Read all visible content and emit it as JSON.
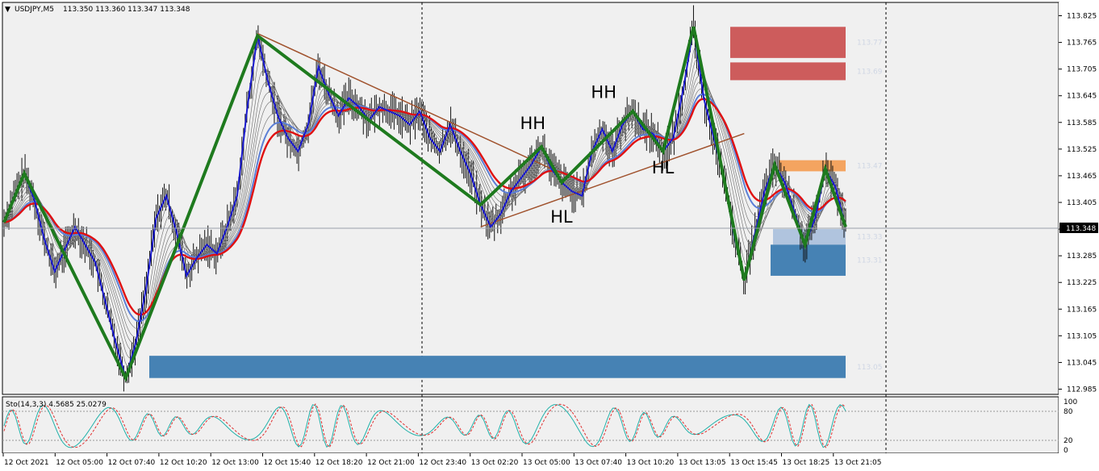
{
  "window": {
    "symbol_title": "USDJPY,M5",
    "ohlc": "113.350 113.360 113.347 113.348",
    "current_price": "113.348",
    "stochastic_label": "Sto(14,3,3) 4.5685 25.0279"
  },
  "colors": {
    "background": "#f0f0f0",
    "bull_candle": "#000000",
    "price_zigzag": "#1a1ad0",
    "trend_zigzag": "#1e7a1e",
    "trend_line": "#a0522d",
    "ema_red": "#e01010",
    "ema_blue": "#5b7fd6",
    "sell_zone": "#cd5c5c",
    "buy_zone": "#4682b4",
    "stoch_main": "#20b2aa",
    "stoch_signal": "#e03030"
  },
  "chart_data": [
    {
      "type": "line",
      "name": "USDJPY M5 price chart",
      "price_axis_labels": [
        "113.825",
        "113.765",
        "113.705",
        "113.645",
        "113.585",
        "113.525",
        "113.465",
        "113.405",
        "113.345",
        "113.285",
        "113.225",
        "113.165",
        "113.105",
        "113.045",
        "112.985"
      ],
      "ylim": [
        112.975,
        113.835
      ],
      "time_axis_labels": [
        "12 Oct 2021",
        "12 Oct 05:00",
        "12 Oct 07:40",
        "12 Oct 10:20",
        "12 Oct 13:00",
        "12 Oct 15:40",
        "12 Oct 18:20",
        "12 Oct 21:00",
        "12 Oct 23:40",
        "13 Oct 02:20",
        "13 Oct 05:00",
        "13 Oct 07:40",
        "13 Oct 10:20",
        "13 Oct 13:05",
        "13 Oct 15:45",
        "13 Oct 18:25",
        "13 Oct 21:05"
      ],
      "price_path": [
        [
          0,
          113.36
        ],
        [
          1,
          113.42
        ],
        [
          2,
          113.47
        ],
        [
          3,
          113.41
        ],
        [
          4,
          113.32
        ],
        [
          5,
          113.25
        ],
        [
          6,
          113.3
        ],
        [
          7,
          113.35
        ],
        [
          8,
          113.31
        ],
        [
          9,
          113.27
        ],
        [
          10,
          113.18
        ],
        [
          11,
          113.09
        ],
        [
          12,
          113.01
        ],
        [
          13,
          113.09
        ],
        [
          14,
          113.21
        ],
        [
          15,
          113.37
        ],
        [
          16,
          113.42
        ],
        [
          17,
          113.34
        ],
        [
          18,
          113.24
        ],
        [
          19,
          113.28
        ],
        [
          20,
          113.31
        ],
        [
          21,
          113.29
        ],
        [
          22,
          113.35
        ],
        [
          23,
          113.42
        ],
        [
          24,
          113.62
        ],
        [
          25,
          113.78
        ],
        [
          26,
          113.68
        ],
        [
          27,
          113.6
        ],
        [
          28,
          113.55
        ],
        [
          29,
          113.52
        ],
        [
          30,
          113.58
        ],
        [
          31,
          113.71
        ],
        [
          32,
          113.65
        ],
        [
          33,
          113.6
        ],
        [
          34,
          113.64
        ],
        [
          35,
          113.62
        ],
        [
          36,
          113.59
        ],
        [
          37,
          113.62
        ],
        [
          38,
          113.61
        ],
        [
          39,
          113.6
        ],
        [
          40,
          113.58
        ],
        [
          41,
          113.61
        ],
        [
          42,
          113.55
        ],
        [
          43,
          113.52
        ],
        [
          44,
          113.58
        ],
        [
          45,
          113.52
        ],
        [
          46,
          113.47
        ],
        [
          47,
          113.4
        ],
        [
          48,
          113.35
        ],
        [
          49,
          113.38
        ],
        [
          50,
          113.43
        ],
        [
          51,
          113.46
        ],
        [
          52,
          113.49
        ],
        [
          53,
          113.53
        ],
        [
          54,
          113.48
        ],
        [
          55,
          113.45
        ],
        [
          56,
          113.43
        ],
        [
          57,
          113.42
        ],
        [
          58,
          113.52
        ],
        [
          59,
          113.57
        ],
        [
          60,
          113.52
        ],
        [
          61,
          113.58
        ],
        [
          62,
          113.61
        ],
        [
          63,
          113.57
        ],
        [
          64,
          113.56
        ],
        [
          65,
          113.52
        ],
        [
          66,
          113.55
        ],
        [
          67,
          113.66
        ],
        [
          68,
          113.8
        ],
        [
          69,
          113.64
        ],
        [
          70,
          113.55
        ],
        [
          71,
          113.46
        ],
        [
          72,
          113.33
        ],
        [
          73,
          113.23
        ],
        [
          74,
          113.33
        ],
        [
          75,
          113.43
        ],
        [
          76,
          113.49
        ],
        [
          77,
          113.45
        ],
        [
          78,
          113.38
        ],
        [
          79,
          113.31
        ],
        [
          80,
          113.37
        ],
        [
          81,
          113.48
        ],
        [
          82,
          113.44
        ],
        [
          83,
          113.35
        ]
      ],
      "annotations": [
        {
          "text": "HH",
          "x": 52,
          "y": 113.57
        },
        {
          "text": "HL",
          "x": 55,
          "y": 113.36
        },
        {
          "text": "HH",
          "x": 59,
          "y": 113.64
        },
        {
          "text": "HL",
          "x": 65,
          "y": 113.47
        }
      ],
      "zones": [
        {
          "kind": "sell",
          "from": 113.73,
          "to": 113.8,
          "label": "113.77"
        },
        {
          "kind": "sell",
          "from": 113.68,
          "to": 113.72,
          "label": "113.69"
        },
        {
          "kind": "supply",
          "from": 113.475,
          "to": 113.5,
          "label": "113.47"
        },
        {
          "kind": "buy",
          "from": 113.31,
          "to": 113.345,
          "label": "113.33"
        },
        {
          "kind": "buy",
          "from": 113.24,
          "to": 113.31,
          "label": "113.31"
        },
        {
          "kind": "buy",
          "from": 113.01,
          "to": 113.06,
          "label": "113.05"
        }
      ],
      "grid": false
    },
    {
      "type": "line",
      "name": "Stochastic (14,3,3)",
      "levels": [
        "100",
        "80",
        "20",
        "0"
      ],
      "ylim": [
        0,
        100
      ]
    }
  ]
}
